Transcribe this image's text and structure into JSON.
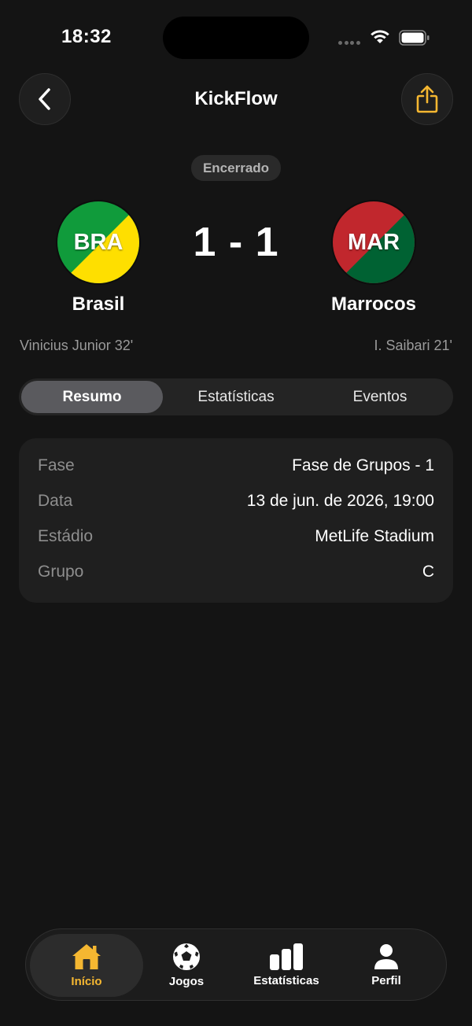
{
  "status_bar": {
    "time": "18:32"
  },
  "header": {
    "title": "KickFlow",
    "back_icon": "chevron-left-icon",
    "share_icon": "share-icon"
  },
  "match": {
    "status": "Encerrado",
    "score": "1 - 1",
    "home": {
      "code": "BRA",
      "name": "Brasil",
      "scorer": "Vinicius Junior 32'",
      "colors": [
        "#109b3b",
        "#fedf00"
      ]
    },
    "away": {
      "code": "MAR",
      "name": "Marrocos",
      "scorer": "I. Saibari 21'",
      "colors": [
        "#c1272d",
        "#006233"
      ]
    }
  },
  "tabs": {
    "selected": "Resumo",
    "items": [
      {
        "label": "Resumo"
      },
      {
        "label": "Estatísticas"
      },
      {
        "label": "Eventos"
      }
    ]
  },
  "details": [
    {
      "label": "Fase",
      "value": "Fase de Grupos - 1"
    },
    {
      "label": "Data",
      "value": "13 de jun. de 2026, 19:00"
    },
    {
      "label": "Estádio",
      "value": "MetLife Stadium"
    },
    {
      "label": "Grupo",
      "value": "C"
    }
  ],
  "tab_bar": {
    "selected": "Início",
    "items": [
      {
        "label": "Início",
        "icon": "house-icon"
      },
      {
        "label": "Jogos",
        "icon": "soccer-ball-icon"
      },
      {
        "label": "Estatísticas",
        "icon": "bar-chart-icon"
      },
      {
        "label": "Perfil",
        "icon": "person-icon"
      }
    ]
  },
  "colors": {
    "background": "#141414",
    "accent": "#f5b731",
    "card": "#1f1f1f",
    "muted_text": "#8e8e8e"
  }
}
